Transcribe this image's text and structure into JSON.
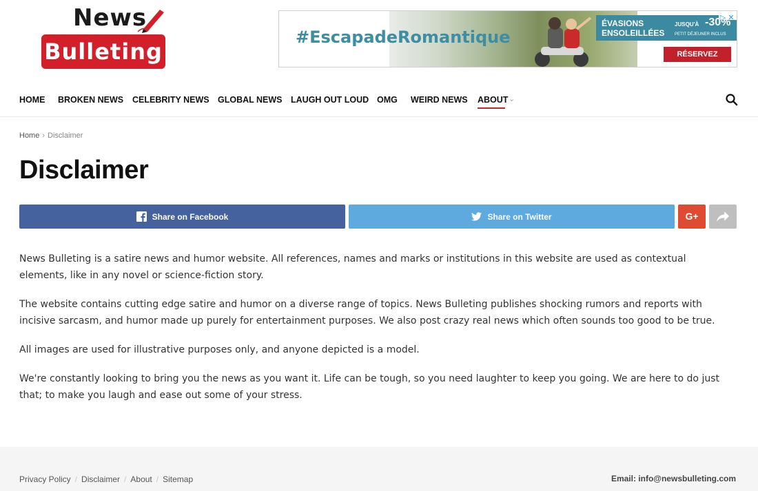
{
  "logo": {
    "top_word": "News",
    "bottom_word": "Bulleting"
  },
  "ad": {
    "hashtag": "#EscapadeRomantique",
    "panel_line1": "ÉVASIONS",
    "panel_line2": "ENSOLEILLÉES",
    "panel_prefix": "JUSQU'À",
    "panel_percent": "-30%",
    "panel_small": "PETIT DÉJEUNER INCLUS",
    "cta": "RÉSERVEZ"
  },
  "nav": {
    "items": [
      "HOME",
      "BROKEN NEWS",
      "CELEBRITY NEWS",
      "GLOBAL NEWS",
      "LAUGH OUT LOUD",
      "OMG",
      "WEIRD NEWS",
      "ABOUT"
    ],
    "active": "ABOUT"
  },
  "breadcrumb": {
    "home": "Home",
    "separator": "›",
    "current": "Disclaimer"
  },
  "page": {
    "title": "Disclaimer"
  },
  "share": {
    "facebook": "Share on Facebook",
    "twitter": "Share on Twitter",
    "gplus": "G+"
  },
  "content": {
    "paragraphs": [
      "News Bulleting is a satire news and humor website. All references, names and marks or institutions in this website are used as contextual elements, like in any novel or science-fiction story.",
      "The website contains cutting edge satire and humor on a diverse range of topics. News Bulleting publishes shocking rumors and reports with incisive sarcasm, and humor made up purely for entertainment purposes. We also post crazy real news which often sounds too good to be true.",
      "All images are used for illustrative purposes only, and anyone depicted is a model.",
      "We're constantly looking to bring you the news as you want it. Life can be tough, so you need laughter to keep you going. We are here to do just that; to make you laugh and ease out some of your stress."
    ]
  },
  "footer": {
    "links": [
      "Privacy Policy",
      "Disclaimer",
      "About",
      "Sitemap"
    ],
    "separator": "/",
    "email": "Email: info@newsbulleting.com"
  },
  "colors": {
    "brand_red": "#d31f2a",
    "facebook": "#45629f",
    "twitter": "#5eaade",
    "gplus": "#df4a32",
    "more": "#bfbfbf"
  }
}
